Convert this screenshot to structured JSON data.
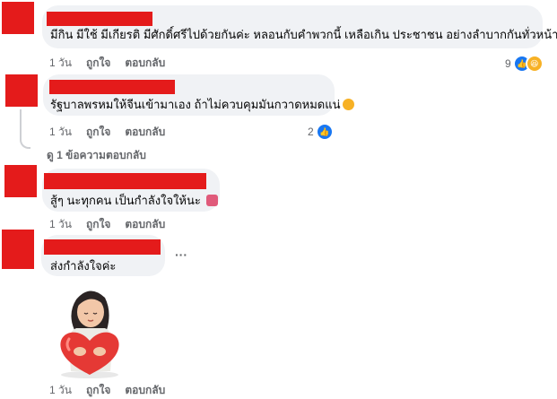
{
  "comments": [
    {
      "text": "มีกิน มีใช้ มีเกียรติ มีศักดิ์ศรีไปด้วยกันค่ะ หลอนกับคำพวกนี้ เหลือเกิน ประชาชน อย่างลำบากกันทั่วหน้า",
      "time": "1 วัน",
      "like": "ถูกใจ",
      "reply": "ตอบกลับ",
      "reaction_count": "9",
      "reactions": [
        "like-icon",
        "haha-icon"
      ]
    },
    {
      "text": "รัฐบาลพรหมให้จีนเข้ามาเอง ถ้าไม่ควบคุมมันกวาดหมดแน่",
      "time": "1 วัน",
      "like": "ถูกใจ",
      "reply": "ตอบกลับ",
      "reaction_count": "2",
      "reactions": [
        "like-icon"
      ],
      "view_replies": "ดู 1 ข้อความตอบกลับ"
    },
    {
      "text": "สู้ๆ นะทุกคน เป็นกำลังใจให้นะ",
      "time": "1 วัน",
      "like": "ถูกใจ",
      "reply": "ตอบกลับ"
    },
    {
      "text": "ส่งกำลังใจค่ะ",
      "more": "···",
      "sticker": "woman-hugging-heart-sticker",
      "time": "1 วัน",
      "like": "ถูกใจ",
      "reply": "ตอบกลับ"
    }
  ],
  "colors": {
    "redaction": "#e41b1b",
    "bubble": "#f0f2f5",
    "meta": "#65676b",
    "like": "#1877f2"
  }
}
